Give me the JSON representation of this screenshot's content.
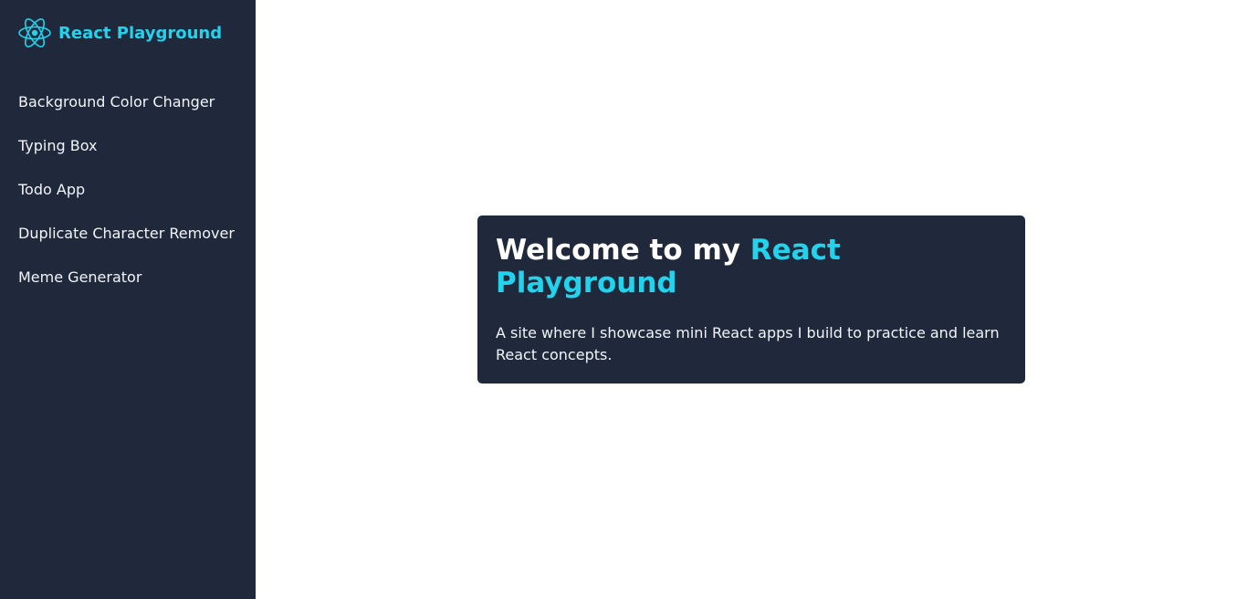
{
  "brand": {
    "title": "React Playground",
    "icon": "react-logo-icon",
    "accent_color": "#22d3ee"
  },
  "sidebar": {
    "background": "#1f293b",
    "items": [
      {
        "label": "Background Color Changer"
      },
      {
        "label": "Typing Box"
      },
      {
        "label": "Todo App"
      },
      {
        "label": "Duplicate Character Remover"
      },
      {
        "label": "Meme Generator"
      }
    ]
  },
  "welcome": {
    "heading_prefix": "Welcome to my ",
    "heading_accent": "React Playground",
    "description": "A site where I showcase mini React apps I build to practice and learn React concepts."
  }
}
